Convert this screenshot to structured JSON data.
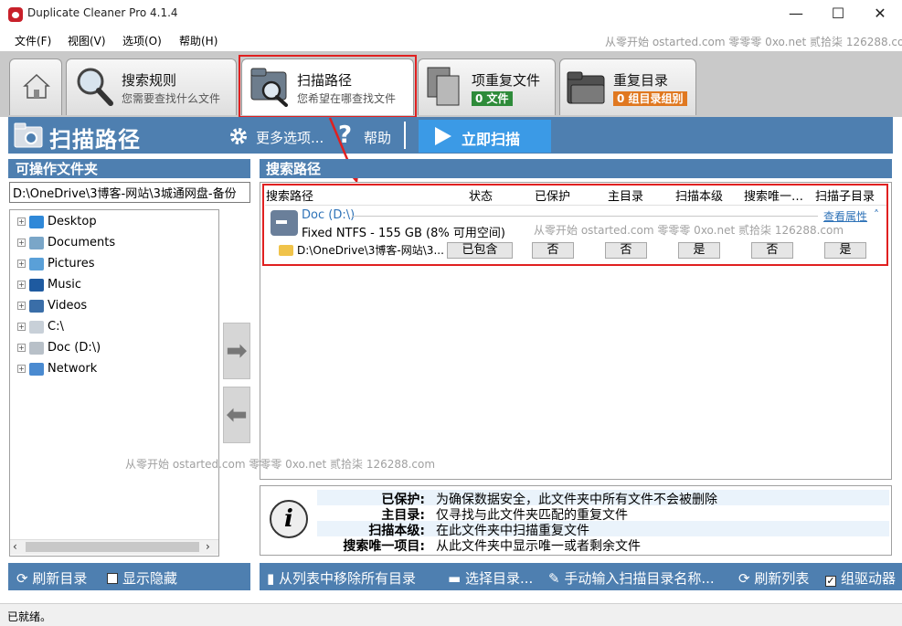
{
  "window": {
    "title": "Duplicate Cleaner Pro 4.1.4",
    "minimize": "—",
    "maximize": "☐",
    "close": "✕"
  },
  "menu": {
    "file": "文件(F)",
    "view": "视图(V)",
    "options": "选项(O)",
    "help": "帮助(H)"
  },
  "watermark": {
    "top": "从零开始 ostarted.com 零零零 0xo.net 贰拾柒 126288.com",
    "mid": "从零开始 ostarted.com 零零零 0xo.net 贰拾柒 126288.com",
    "left": "从零开始 ostarted.com 零零零 0xo.net 贰拾柒 126288.com"
  },
  "tabs": {
    "criteria": {
      "title": "搜索规则",
      "sub": "您需要查找什么文件"
    },
    "scan_path": {
      "title": "扫描路径",
      "sub": "您希望在哪查找文件"
    },
    "duplicates": {
      "title": "项重复文件",
      "badge": "0 文件"
    },
    "dup_folders": {
      "title": "重复目录",
      "badge": "0 组目录组别"
    }
  },
  "toolbar": {
    "title": "扫描路径",
    "more": "更多选项...",
    "help": "帮助",
    "scan_now": "立即扫描"
  },
  "left_panel": {
    "header": "可操作文件夹",
    "path_value": "D:\\OneDrive\\3博客-网站\\3城通网盘-备份",
    "tree": [
      "Desktop",
      "Documents",
      "Pictures",
      "Music",
      "Videos",
      "C:\\",
      "Doc (D:\\)",
      "Network"
    ]
  },
  "right_panel": {
    "header": "搜索路径",
    "columns": [
      "搜索路径",
      "状态",
      "已保护",
      "主目录",
      "扫描本级",
      "搜索唯一…",
      "扫描子目录"
    ],
    "drive": {
      "name": "Doc (D:\\)",
      "info": "Fixed NTFS - 155 GB (8% 可用空间)",
      "view_props": "查看属性",
      "collapse": "˄"
    },
    "row": {
      "path": "D:\\OneDrive\\3博客-网站\\3...",
      "status": "已包含",
      "protected": "否",
      "master": "否",
      "scan_level": "是",
      "unique": "否",
      "subfolders": "是"
    }
  },
  "info": {
    "icon": "i",
    "rows": [
      {
        "key": "已保护:",
        "value": "为确保数据安全，此文件夹中所有文件不会被删除"
      },
      {
        "key": "主目录:",
        "value": "仅寻找与此文件夹匹配的重复文件"
      },
      {
        "key": "扫描本级:",
        "value": "在此文件夹中扫描重复文件"
      },
      {
        "key": "搜索唯一项目:",
        "value": "从此文件夹中显示唯一或者剩余文件"
      }
    ]
  },
  "bottom_left": {
    "refresh": "刷新目录",
    "show_hidden": "显示隐藏"
  },
  "bottom_right": {
    "remove_all": "从列表中移除所有目录",
    "select_dir": "选择目录...",
    "manual_input": "手动输入扫描目录名称...",
    "refresh_list": "刷新列表",
    "group_drive": "组驱动器"
  },
  "status": "已就绪。",
  "colors": {
    "accent_blue": "#4e7fb0",
    "scan_button": "#3b9ae6",
    "highlight_red": "#e02020",
    "link_blue": "#2f73b8",
    "badge_green": "#2e8b3a",
    "badge_orange": "#e07820"
  }
}
